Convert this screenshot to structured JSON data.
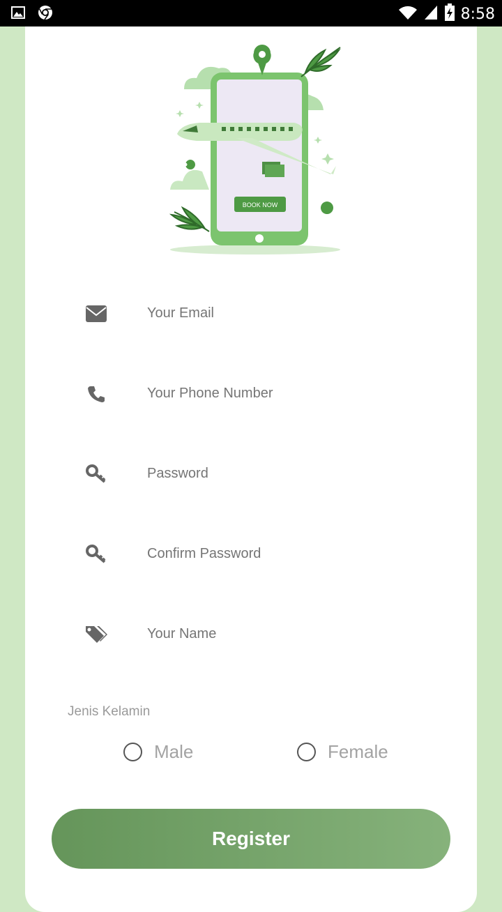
{
  "status_bar": {
    "time": "8:58"
  },
  "illustration": {
    "book_label": "BOOK NOW"
  },
  "form": {
    "email_placeholder": "Your Email",
    "phone_placeholder": "Your Phone Number",
    "password_placeholder": "Password",
    "confirm_password_placeholder": "Confirm Password",
    "name_placeholder": "Your Name"
  },
  "gender": {
    "label": "Jenis Kelamin",
    "options": [
      "Male",
      "Female"
    ]
  },
  "register_label": "Register",
  "colors": {
    "background": "#cfe8c4",
    "accent_start": "#65955a",
    "accent_end": "#86b27b",
    "illustration_green": "#7cc46e"
  }
}
